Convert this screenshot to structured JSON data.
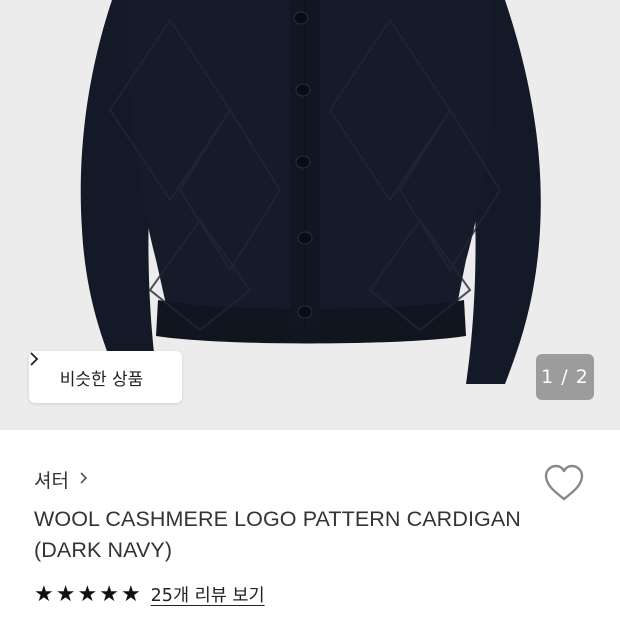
{
  "hero": {
    "similar_button_label": "비슷한 상품",
    "similar_button_chevron": "chevron-right-icon",
    "image_counter": "1 / 2",
    "product_colors": {
      "background": "#ececec",
      "garment": "#151a27",
      "buttons": "#0b0d14"
    }
  },
  "info": {
    "category_label": "셔터",
    "category_chevron": "chevron-right-icon",
    "title_line1": "WOOL CASHMERE LOGO PATTERN CARDIGAN",
    "title_line2": "(DARK NAVY)",
    "rating": {
      "stars_filled": 5,
      "stars_total": 5,
      "star_color": "#111111"
    },
    "review_link": "25개 리뷰 보기",
    "wishlist_icon": "heart-outline-icon"
  }
}
